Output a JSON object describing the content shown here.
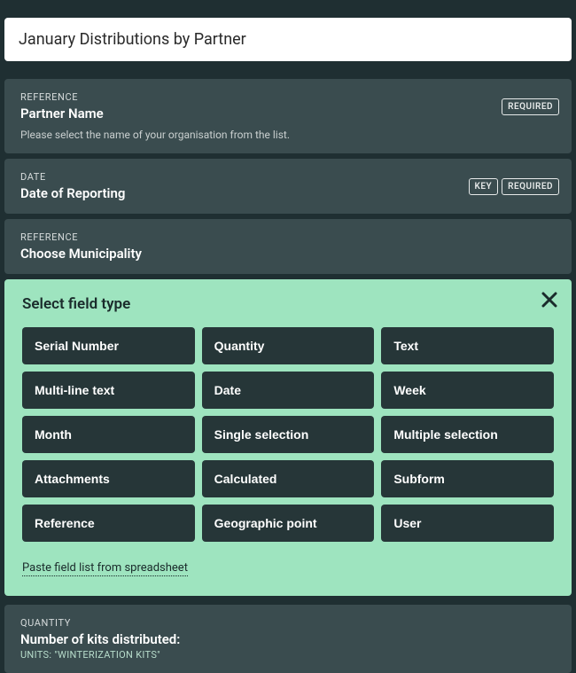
{
  "form": {
    "title": "January Distributions by Partner"
  },
  "fields": [
    {
      "type_label": "REFERENCE",
      "title": "Partner Name",
      "hint": "Please select the name of your organisation from the list.",
      "badges": [
        "REQUIRED"
      ]
    },
    {
      "type_label": "DATE",
      "title": "Date of Reporting",
      "badges": [
        "KEY",
        "REQUIRED"
      ]
    },
    {
      "type_label": "REFERENCE",
      "title": "Choose Municipality",
      "badges": []
    }
  ],
  "field_type_selector": {
    "heading": "Select field type",
    "types": [
      "Serial Number",
      "Quantity",
      "Text",
      "Multi-line text",
      "Date",
      "Week",
      "Month",
      "Single selection",
      "Multiple selection",
      "Attachments",
      "Calculated",
      "Subform",
      "Reference",
      "Geographic point",
      "User"
    ],
    "paste_link": "Paste field list from spreadsheet"
  },
  "quantity_field": {
    "type_label": "QUANTITY",
    "title": "Number of kits distributed:",
    "units": "UNITS: \"WINTERIZATION KITS\""
  }
}
